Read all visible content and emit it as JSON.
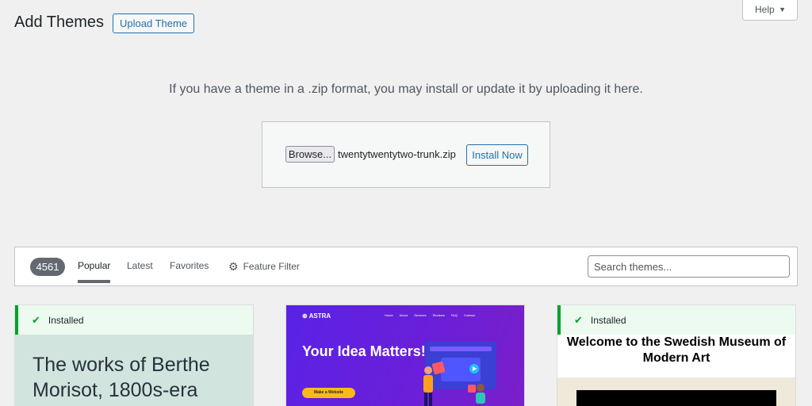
{
  "header": {
    "title": "Add Themes",
    "upload_label": "Upload Theme",
    "help_label": "Help"
  },
  "upload": {
    "hint": "If you have a theme in a .zip format, you may install or update it by uploading it here.",
    "browse_label": "Browse...",
    "file_name": "twentytwentytwo-trunk.zip",
    "install_label": "Install Now"
  },
  "filter": {
    "count": "4561",
    "tabs": [
      {
        "label": "Popular",
        "current": true
      },
      {
        "label": "Latest",
        "current": false
      },
      {
        "label": "Favorites",
        "current": false
      }
    ],
    "feature_filter_label": "Feature Filter",
    "search_placeholder": "Search themes..."
  },
  "themes": [
    {
      "installed_label": "Installed",
      "screenshot_text": "The works of Berthe Morisot, 1800s-era"
    },
    {
      "brand": "ASTRA",
      "nav": "Home About Services Reviews FAQ Contact",
      "headline": "Your Idea Matters!",
      "cta": "Make a Website"
    },
    {
      "installed_label": "Installed",
      "screenshot_text": "Welcome to the Swedish Museum of Modern Art"
    }
  ],
  "colors": {
    "accent": "#2271b1",
    "installed_green": "#00a32a",
    "page_bg": "#f0f0f1"
  }
}
